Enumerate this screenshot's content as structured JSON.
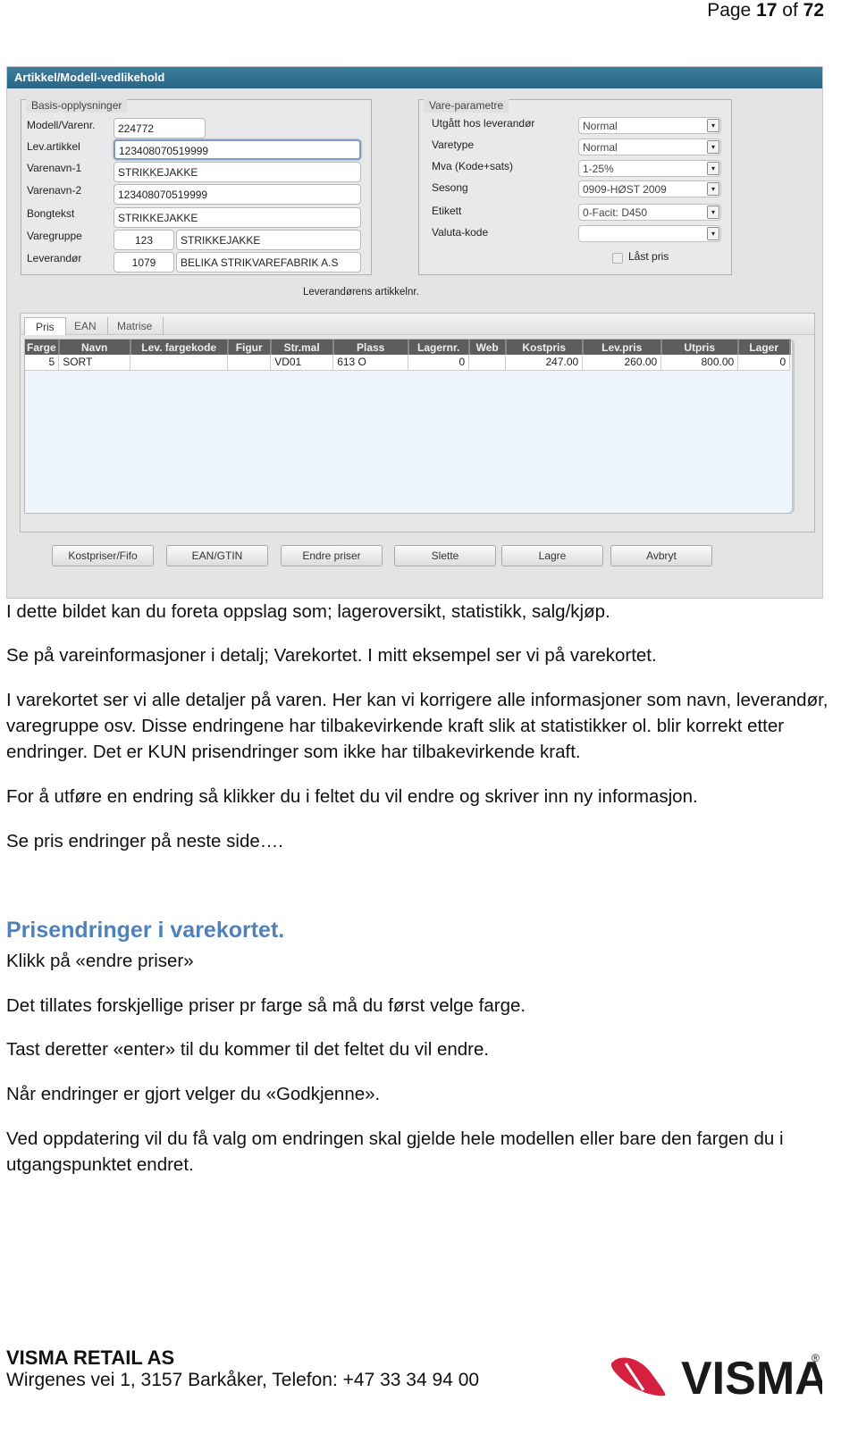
{
  "header": {
    "page_prefix": "Page",
    "page_current": "17",
    "page_of": "of",
    "page_total": "72"
  },
  "window": {
    "title": "Artikkel/Modell-vedlikehold",
    "basis": {
      "legend": "Basis-opplysninger",
      "fields": [
        {
          "label": "Modell/Varenr.",
          "value": "224772"
        },
        {
          "label": "Lev.artikkel",
          "value": "123408070519999"
        },
        {
          "label": "Varenavn-1",
          "value": "STRIKKEJAKKE"
        },
        {
          "label": "Varenavn-2",
          "value": "123408070519999"
        },
        {
          "label": "Bongtekst",
          "value": "STRIKKEJAKKE"
        },
        {
          "label": "Varegruppe",
          "code": "123",
          "value": "STRIKKEJAKKE"
        },
        {
          "label": "Leverandør",
          "code": "1079",
          "value": "BELIKA STRIKVAREFABRIK A.S"
        }
      ]
    },
    "params": {
      "legend": "Vare-parametre",
      "fields": [
        {
          "label": "Utgått hos leverandør",
          "value": "Normal"
        },
        {
          "label": "Varetype",
          "value": "Normal"
        },
        {
          "label": "Mva (Kode+sats)",
          "value": "1-25%"
        },
        {
          "label": "Sesong",
          "value": "0909-HØST 2009"
        },
        {
          "label": "Etikett",
          "value": "0-Facit: D450"
        },
        {
          "label": "Valuta-kode",
          "value": ""
        }
      ],
      "locked_price_label": "Låst pris",
      "locked_price_checked": false
    },
    "hint_label": "Leverandørens artikkelnr.",
    "tabs": [
      {
        "label": "Pris",
        "active": true
      },
      {
        "label": "EAN",
        "active": false
      },
      {
        "label": "Matrise",
        "active": false
      }
    ],
    "table": {
      "columns": [
        "Farge",
        "Navn",
        "Lev. fargekode",
        "Figur",
        "Str.mal",
        "Plass",
        "Lagernr.",
        "Web",
        "Kostpris",
        "Lev.pris",
        "Utpris",
        "Lager"
      ],
      "rows": [
        [
          "5",
          "SORT",
          "",
          "",
          "VD01",
          "613 O",
          "0",
          "",
          "247.00",
          "260.00",
          "800.00",
          "0"
        ]
      ]
    },
    "buttons": [
      "Kostpriser/Fifo",
      "EAN/GTIN",
      "Endre priser",
      "Slette",
      "Lagre",
      "Avbryt"
    ],
    "dropdown_arrow_icon": "▾"
  },
  "body": {
    "paragraphs": [
      "I dette bildet kan du foreta oppslag som; lageroversikt, statistikk, salg/kjøp.",
      "Se på vareinformasjoner i detalj; Varekortet. I mitt eksempel ser vi på varekortet.",
      "I varekortet ser vi alle detaljer på varen. Her kan vi korrigere alle informasjoner som navn, leverandør, varegruppe osv. Disse endringene har tilbakevirkende kraft slik at statistikker ol. blir korrekt etter endringer. Det er KUN prisendringer som ikke har tilbakevirkende kraft.",
      "For å utføre en endring så klikker du i feltet du vil endre og skriver inn ny informasjon.",
      "Se pris endringer på neste side…."
    ],
    "heading": "Prisendringer i varekortet.",
    "heading_color": "#4f81bd",
    "paragraphs2": [
      "Klikk på «endre priser»",
      "Det tillates forskjellige priser pr farge så må du først velge farge.",
      "Tast deretter «enter» til du kommer til det feltet du vil endre.",
      "Når endringer er gjort velger du «Godkjenne».",
      "Ved oppdatering vil du få valg om endringen skal gjelde hele modellen eller bare den fargen du i utgangspunktet endret."
    ]
  },
  "footer": {
    "company": "VISMA RETAIL AS",
    "address": "Wirgenes vei 1, 3157 Barkåker, Telefon: +47 33 34 94 00",
    "logo_text": "VISMA",
    "logo_mark": "®",
    "logo_color": "#d5213f"
  }
}
